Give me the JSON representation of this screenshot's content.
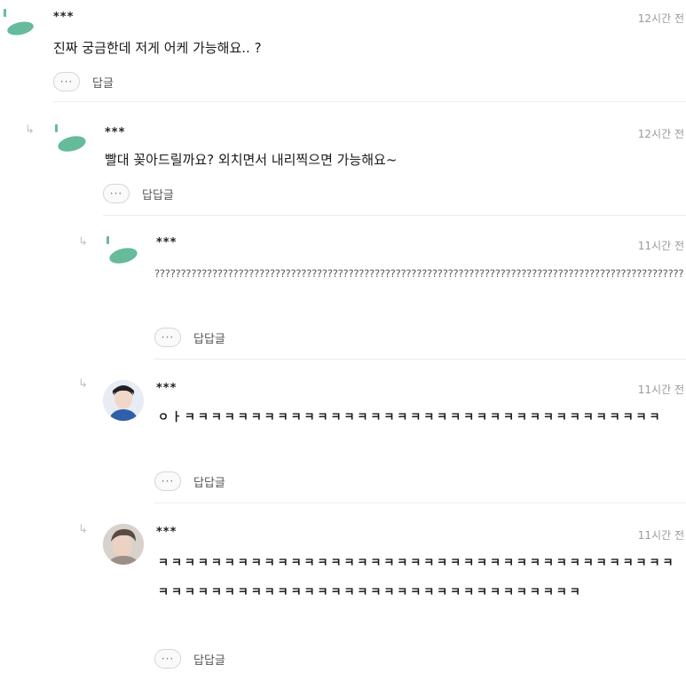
{
  "comments": [
    {
      "author": "***",
      "time": "12시간 전",
      "text": "진짜 궁금한데 저게 어케 가능해요.. ?",
      "more": "···",
      "reply_label": "답글"
    },
    {
      "author": "***",
      "time": "12시간 전",
      "text": "빨대 꽂아드릴까요? 외치면서 내리찍으면 가능해요~",
      "more": "···",
      "reply_label": "답답글"
    },
    {
      "author": "***",
      "time": "11시간 전",
      "text": "????????????????????????????????????????????????????????????????????????????????????????????????????????????????????????????????????????",
      "more": "···",
      "reply_label": "답답글"
    },
    {
      "author": "***",
      "time": "11시간 전",
      "text": "ㅇㅏㅋㅋㅋㅋㅋㅋㅋㅋㅋㅋㅋㅋㅋㅋㅋㅋㅋㅋㅋㅋㅋㅋㅋㅋㅋㅋㅋㅋㅋㅋㅋㅋㅋㅋㅋㅋ",
      "more": "···",
      "reply_label": "답답글"
    },
    {
      "author": "***",
      "time": "11시간 전",
      "text": "ㅋㅋㅋㅋㅋㅋㅋㅋㅋㅋㅋㅋㅋㅋㅋㅋㅋㅋㅋㅋㅋㅋㅋㅋㅋㅋㅋㅋㅋㅋㅋㅋㅋㅋㅋㅋㅋㅋㅋㅋㅋㅋㅋㅋㅋㅋㅋㅋㅋㅋㅋㅋㅋㅋㅋㅋㅋㅋㅋㅋㅋㅋㅋㅋㅋㅋㅋㅋㅋㅋㅋ",
      "more": "···",
      "reply_label": "답답글"
    }
  ],
  "reply_arrow": "↳",
  "colors": {
    "leaf": "#66bb9a",
    "divider": "#eeeeee",
    "meta": "#9a9a9a"
  }
}
